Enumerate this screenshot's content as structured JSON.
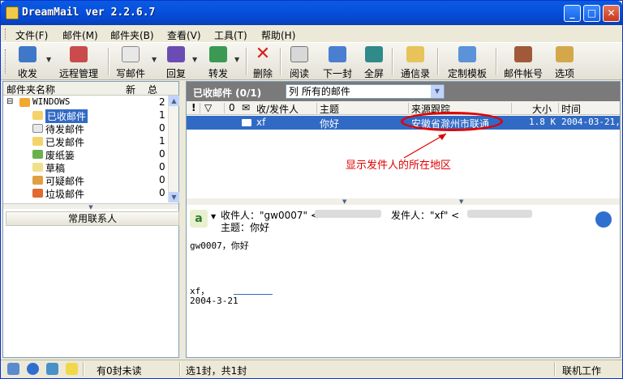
{
  "window": {
    "title": "DreamMail ver 2.2.6.7",
    "controls": {
      "minimize": "_",
      "maximize": "□",
      "close": "✕"
    }
  },
  "menu": {
    "items": [
      "文件(F)",
      "邮件(M)",
      "邮件夹(B)",
      "查看(V)",
      "工具(T)",
      "帮助(H)"
    ]
  },
  "toolbar": {
    "buttons": [
      {
        "label": "收发",
        "icon": "send-receive-icon"
      },
      {
        "label": "远程管理",
        "icon": "remote-manage-icon"
      },
      {
        "label": "写邮件",
        "icon": "compose-icon"
      },
      {
        "label": "回复",
        "icon": "reply-icon"
      },
      {
        "label": "转发",
        "icon": "forward-icon"
      },
      {
        "label": "删除",
        "icon": "delete-icon"
      },
      {
        "label": "阅读",
        "icon": "read-icon"
      },
      {
        "label": "下一封",
        "icon": "next-icon"
      },
      {
        "label": "全屏",
        "icon": "fullscreen-icon"
      },
      {
        "label": "通信录",
        "icon": "address-book-icon"
      },
      {
        "label": "定制模板",
        "icon": "template-icon"
      },
      {
        "label": "邮件帐号",
        "icon": "account-icon"
      },
      {
        "label": "选项",
        "icon": "options-icon"
      }
    ]
  },
  "folders": {
    "header": {
      "name": "邮件夹名称",
      "new": "新",
      "total": "总"
    },
    "root": {
      "expander": "⊟",
      "name": "WINDOWS",
      "total": "2"
    },
    "items": [
      {
        "name": "已收邮件",
        "total": "1",
        "selected": true
      },
      {
        "name": "待发邮件",
        "total": "0"
      },
      {
        "name": "已发邮件",
        "total": "1"
      },
      {
        "name": "废纸篓",
        "total": "0"
      },
      {
        "name": "草稿",
        "total": "0"
      },
      {
        "name": "可疑邮件",
        "total": "0"
      },
      {
        "name": "垃圾邮件",
        "total": "0"
      }
    ],
    "contacts_label": "常用联系人"
  },
  "maillist": {
    "title": "已收邮件 (0/1)",
    "filter": "列 所有的邮件",
    "columns": {
      "flag": "!",
      "mark": "▽",
      "attach": "0",
      "read": "✉",
      "from": "收/发件人",
      "subject": "主题",
      "location": "来源跟踪",
      "size": "大小",
      "time": "时间"
    },
    "rows": [
      {
        "from": "xf",
        "subject": "你好",
        "location": "安徽省滁州市联通",
        "size": "1.8 K",
        "time": "2004-03-21,"
      }
    ]
  },
  "annotation": {
    "text": "显示发件人的所在地区",
    "color": "#E00000"
  },
  "preview": {
    "to_label": "收件人：\"gw0007\" <",
    "from_label": "发件人：\"xf\" <",
    "subject_label": "主题：你好",
    "body_line1": "gw0007，你好",
    "body_line2": "xf，",
    "body_line3": "2004-3-21"
  },
  "status": {
    "unread": "有0封未读",
    "selection": "选1封，共1封",
    "mode": "联机工作"
  }
}
